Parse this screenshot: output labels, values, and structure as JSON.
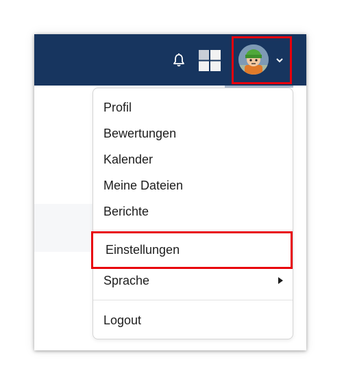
{
  "navbar": {
    "background": "#17355f",
    "notifications_icon": "bell-icon",
    "apps_icon": "grid-icon",
    "avatar_alt": "user-avatar",
    "toggle_icon": "chevron-down-icon"
  },
  "user_menu": {
    "items": [
      {
        "label": "Profil"
      },
      {
        "label": "Bewertungen"
      },
      {
        "label": "Kalender"
      },
      {
        "label": "Meine Dateien"
      },
      {
        "label": "Berichte"
      },
      {
        "label": "Einstellungen"
      },
      {
        "label": "Sprache",
        "has_submenu": true
      },
      {
        "label": "Logout"
      }
    ]
  },
  "highlight_color": "#e8000b"
}
